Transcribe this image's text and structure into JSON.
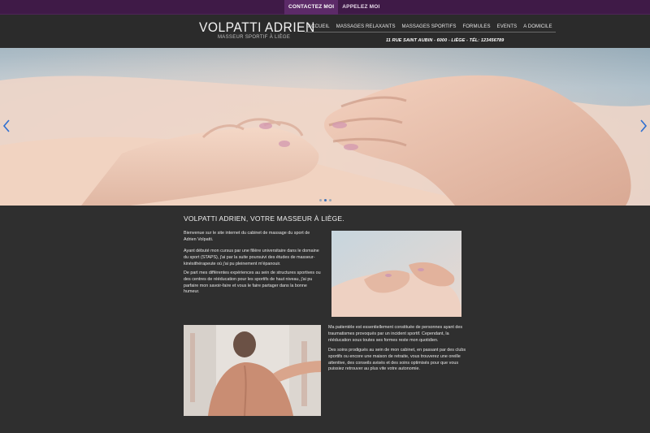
{
  "topbar": {
    "links": [
      {
        "label": "CONTACTEZ MOI"
      },
      {
        "label": "APPELEZ MOI"
      }
    ]
  },
  "header": {
    "title": "VOLPATTI ADRIEN",
    "subtitle": "MASSEUR SPORTIF À LIÈGE",
    "nav": [
      {
        "label": "ACCUEIL"
      },
      {
        "label": "MASSAGES RELAXANTS"
      },
      {
        "label": "MASSAGES SPORTIFS"
      },
      {
        "label": "FORMULES"
      },
      {
        "label": "EVENTS"
      },
      {
        "label": "A DOMICILE"
      }
    ],
    "address": "11 RUE SAINT AUBIN - 6000 - LIÈGE - TÉL: 123456789"
  },
  "hero": {
    "slide_count": 3,
    "active_slide": 1
  },
  "main": {
    "heading": "VOLPATTI ADRIEN, VOTRE MASSEUR À LIÈGE.",
    "paragraphs_left": [
      "Bienvenue sur le site internet du cabinet de massage du sport de Adrien Volpatti.",
      "Ayant débuté mon cursus par une filière universitaire dans le domaine du sport (STAPS), j'ai par la suite poursuivi des études de masseur-kinésithérapeute où j'ai pu pleinement m'épanouir.",
      "De part mes différentes expériences au sein de structures sportives ou des centres de rééducation pour les sportifs de haut niveau, j'ai pu parfaire mon savoir-faire et vous le faire partager dans la bonne humeur."
    ],
    "paragraphs_right": [
      "Ma patientèle est essentiellement constituée de personnes ayant des traumatismes provoqués par un incident sportif. Cependant, la rééducation sous toutes ses formes reste mon quotidien.",
      "Des soins prodigués au sein de mon cabinet, en passant par des clubs sportifs ou encore une maison de retraite, vous trouverez une oreille attentive, des conseils avisés et des soins optimisés pour que vous puissiez retrouver au plus vite votre autonomie."
    ]
  },
  "colors": {
    "topbar": "#3f1a47",
    "accent": "#5c2a68",
    "background": "#2f2f2f",
    "arrow": "#2e6fd1"
  }
}
